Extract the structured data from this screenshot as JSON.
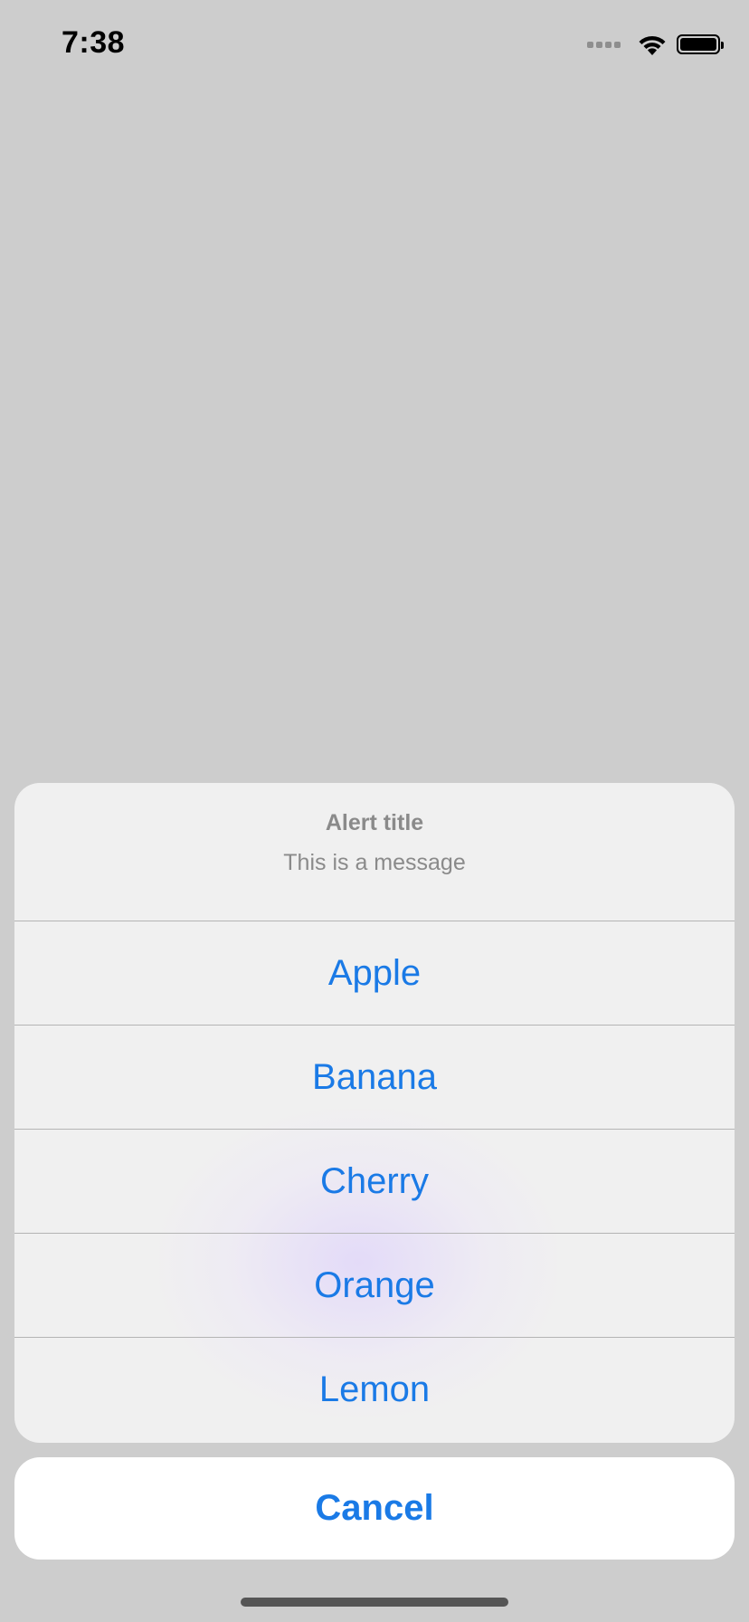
{
  "status_bar": {
    "time": "7:38",
    "icons": [
      "cellular-signal-icon",
      "wifi-icon",
      "battery-icon"
    ],
    "battery_level": 1.0
  },
  "action_sheet": {
    "title": "Alert title",
    "message": "This is a message",
    "options": [
      {
        "label": "Apple"
      },
      {
        "label": "Banana"
      },
      {
        "label": "Cherry"
      },
      {
        "label": "Orange"
      },
      {
        "label": "Lemon"
      }
    ],
    "cancel_label": "Cancel"
  },
  "colors": {
    "background": "#cdcdcd",
    "sheet_background": "#f0f0f0",
    "accent": "#1a7ae6",
    "secondary_text": "#8a8a8a",
    "separator": "#b4b4b4"
  }
}
